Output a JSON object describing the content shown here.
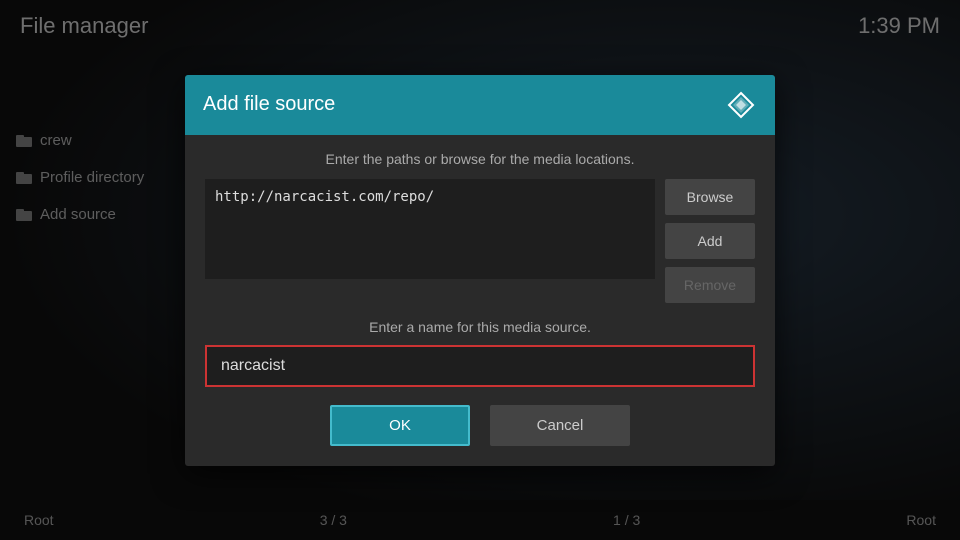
{
  "topbar": {
    "title": "File manager",
    "time": "1:39 PM"
  },
  "sidebar": {
    "items": [
      {
        "label": "crew",
        "icon": "folder-icon"
      },
      {
        "label": "Profile directory",
        "icon": "folder-icon"
      },
      {
        "label": "Add source",
        "icon": "folder-icon"
      }
    ]
  },
  "bottombar": {
    "left": "Root",
    "center_left": "3 / 3",
    "center_right": "1 / 3",
    "right": "Root"
  },
  "dialog": {
    "title": "Add file source",
    "instruction_paths": "Enter the paths or browse for the media locations.",
    "url_value": "http://narcacist.com/repo/",
    "btn_browse": "Browse",
    "btn_add": "Add",
    "btn_remove": "Remove",
    "instruction_name": "Enter a name for this media source.",
    "name_value": "narcacist",
    "btn_ok": "OK",
    "btn_cancel": "Cancel"
  }
}
